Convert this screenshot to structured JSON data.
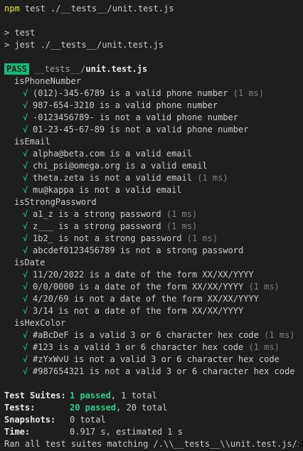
{
  "command": {
    "program": "npm",
    "args": " test ./__tests__/unit.test.js"
  },
  "script_echo": [
    "> test",
    "> jest ./__tests__/unit.test.js"
  ],
  "result": {
    "badge": "PASS",
    "path_dir": "__tests__/",
    "path_file": "unit.test.js"
  },
  "check_glyph": "√",
  "suites": [
    {
      "name": "isPhoneNumber",
      "tests": [
        {
          "text": "(012)-345-6789 is a valid phone number",
          "duration": " (1 ms)"
        },
        {
          "text": "987-654-3210 is a valid phone number",
          "duration": ""
        },
        {
          "text": "-0123456789- is not a valid phone number",
          "duration": ""
        },
        {
          "text": "01-23-45-67-89 is not a valid phone number",
          "duration": ""
        }
      ]
    },
    {
      "name": "isEmail",
      "tests": [
        {
          "text": "alpha@beta.com is a valid email",
          "duration": ""
        },
        {
          "text": "chi_psi@omega.org is a valid email",
          "duration": ""
        },
        {
          "text": "theta.zeta is not a valid email",
          "duration": " (1 ms)"
        },
        {
          "text": "mu@kappa is not a valid email",
          "duration": ""
        }
      ]
    },
    {
      "name": "isStrongPassword",
      "tests": [
        {
          "text": "a1_z is a strong password",
          "duration": " (1 ms)"
        },
        {
          "text": "z___ is a strong password",
          "duration": " (1 ms)"
        },
        {
          "text": "1b2_ is not a strong password",
          "duration": " (1 ms)"
        },
        {
          "text": "abcdef0123456789 is not a strong password",
          "duration": ""
        }
      ]
    },
    {
      "name": "isDate",
      "tests": [
        {
          "text": "11/20/2022 is a date of the form XX/XX/YYYY",
          "duration": ""
        },
        {
          "text": "0/0/0000 is a date of the form XX/XX/YYYY",
          "duration": " (1 ms)"
        },
        {
          "text": "4/20/69 is not a date of the form XX/XX/YYYY",
          "duration": ""
        },
        {
          "text": "3/14 is not a date of the form XX/XX/YYYY",
          "duration": ""
        }
      ]
    },
    {
      "name": "isHexColor",
      "tests": [
        {
          "text": "#aBcDeF is a valid 3 or 6 character hex code",
          "duration": " (1 ms)"
        },
        {
          "text": "#123 is a valid 3 or 6 character hex code",
          "duration": " (1 ms)"
        },
        {
          "text": "#zYxWvU is not a valid 3 or 6 character hex code",
          "duration": ""
        },
        {
          "text": "#987654321 is not a valid 3 or 6 character hex code",
          "duration": ""
        }
      ]
    }
  ],
  "summary": {
    "suites_label": "Test Suites:",
    "suites_passed": "1 passed",
    "suites_total": ", 1 total",
    "tests_label": "Tests:",
    "tests_passed": "20 passed",
    "tests_total": ", 20 total",
    "snapshots_label": "Snapshots:",
    "snapshots_value": "0 total",
    "time_label": "Time:",
    "time_value": "0.917 s, estimated 1 s",
    "footer": "Ran all test suites matching /.\\\\__tests__\\\\unit.test.js/i."
  },
  "colors": {
    "background": "#1e1e1e",
    "pass_badge": "#0dbc79",
    "check": "#23d18b",
    "npm": "#e5e510"
  }
}
